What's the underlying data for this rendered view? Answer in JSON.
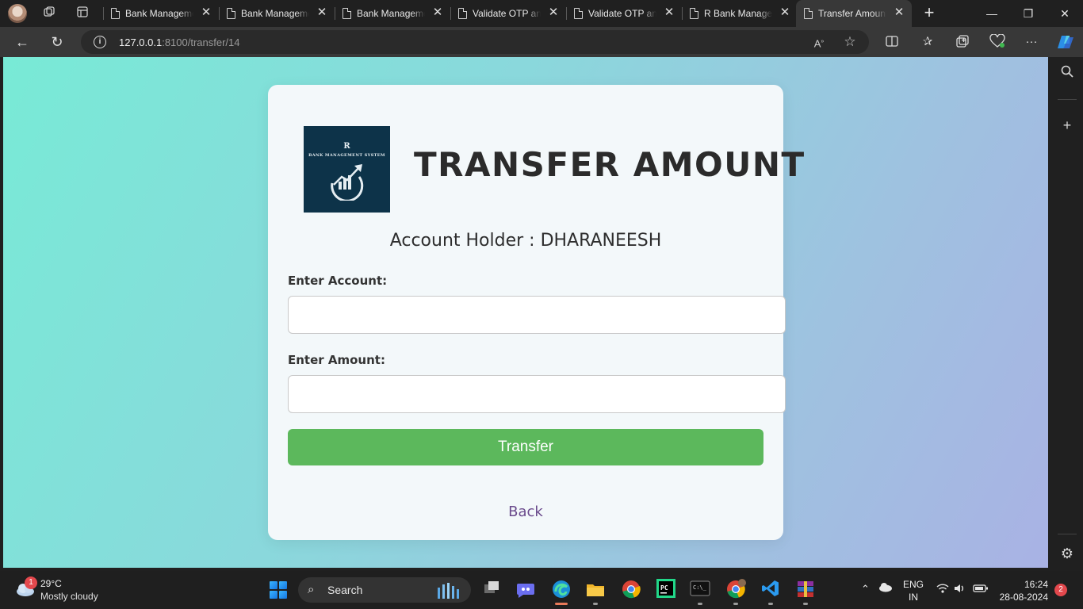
{
  "browser": {
    "tabs": [
      {
        "title": "Bank Management System",
        "active": false
      },
      {
        "title": "Bank Management System",
        "active": false
      },
      {
        "title": "Bank Management System",
        "active": false
      },
      {
        "title": "Validate OTP and Reset",
        "active": false
      },
      {
        "title": "Validate OTP and Reset",
        "active": false
      },
      {
        "title": "R Bank Management",
        "active": false
      },
      {
        "title": "Transfer Amount",
        "active": true
      }
    ],
    "url_host": "127.0.0.1",
    "url_path": ":8100/transfer/14"
  },
  "logo": {
    "letter": "R",
    "text": "BANK MANAGEMENT SYSTEM"
  },
  "page": {
    "heading": "TRANSFER AMOUNT",
    "account_holder": "Account Holder : DHARANEESH",
    "account_label": "Enter Account:",
    "account_value": "",
    "amount_label": "Enter Amount:",
    "amount_value": "",
    "transfer_button": "Transfer",
    "back_link": "Back"
  },
  "taskbar": {
    "weather_badge": "1",
    "temperature": "29°C",
    "condition": "Mostly cloudy",
    "search_label": "Search",
    "lang_line1": "ENG",
    "lang_line2": "IN",
    "time": "16:24",
    "date": "28-08-2024",
    "notification_count": "2"
  },
  "colors": {
    "accent_button": "#5cb85c",
    "logo_bg": "#0d3349",
    "back_link": "#6a4a8c"
  }
}
